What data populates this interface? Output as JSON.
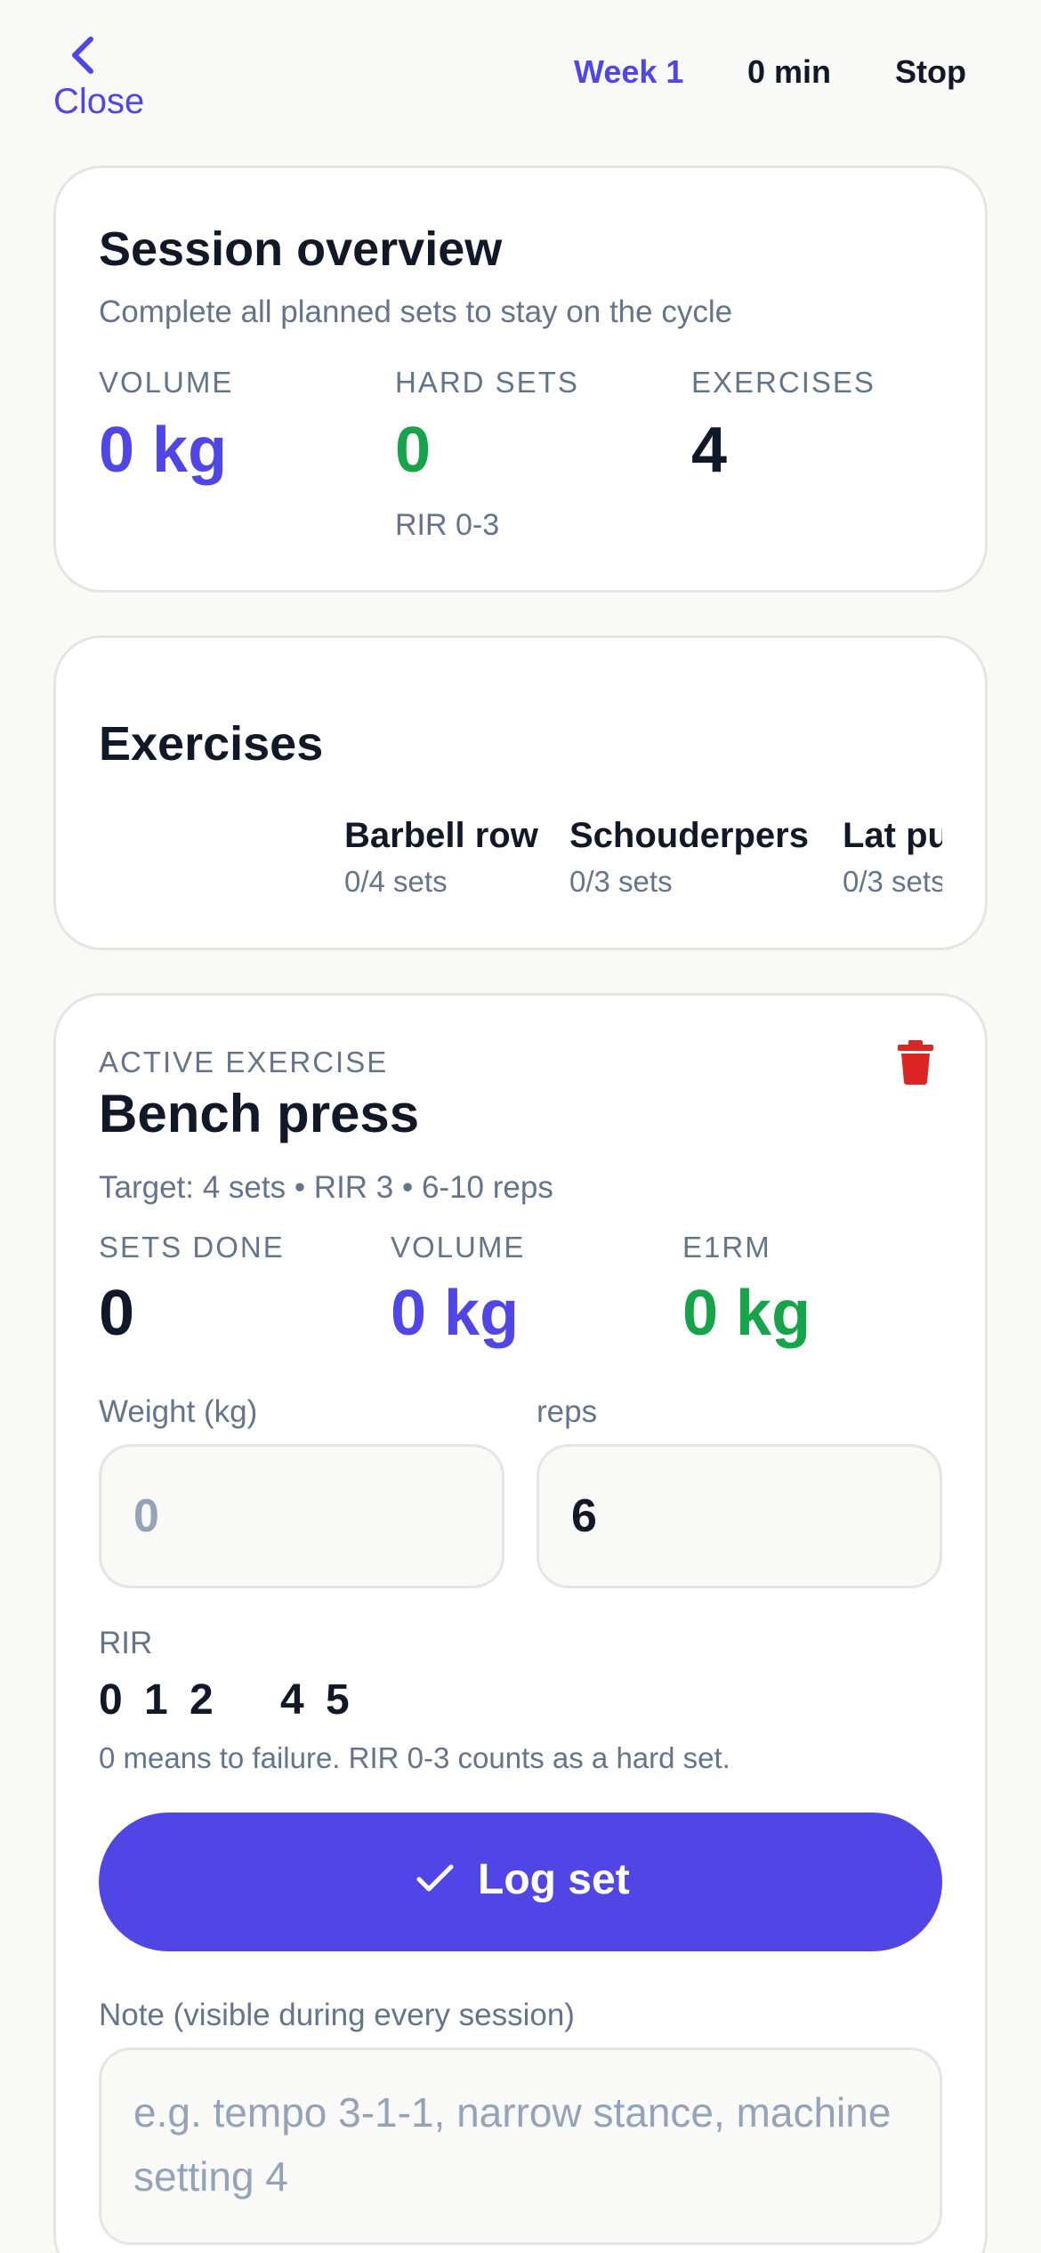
{
  "header": {
    "close_label": "Close",
    "week_label": "Week 1",
    "duration": "0 min",
    "stop_label": "Stop"
  },
  "overview": {
    "title": "Session overview",
    "subtitle": "Complete all planned sets to stay on the cycle",
    "stats": {
      "volume_label": "VOLUME",
      "volume_value": "0 kg",
      "hard_sets_label": "HARD SETS",
      "hard_sets_value": "0",
      "hard_sets_note": "RIR 0-3",
      "exercises_label": "EXERCISES",
      "exercises_value": "4"
    }
  },
  "exercises": {
    "title": "Exercises",
    "items": [
      {
        "name": "Barbell row",
        "sets": "0/4 sets"
      },
      {
        "name": "Schouderpers",
        "sets": "0/3 sets"
      },
      {
        "name": "Lat pulldown",
        "sets": "0/3 sets"
      }
    ]
  },
  "active": {
    "caption": "ACTIVE EXERCISE",
    "name": "Bench press",
    "target": "Target: 4 sets • RIR 3 • 6-10 reps",
    "stats": {
      "sets_done_label": "SETS DONE",
      "sets_done_value": "0",
      "volume_label": "VOLUME",
      "volume_value": "0 kg",
      "e1rm_label": "E1RM",
      "e1rm_value": "0 kg"
    },
    "weight": {
      "label": "Weight (kg)",
      "placeholder": "0",
      "value": ""
    },
    "reps": {
      "label": "reps",
      "value": "6"
    },
    "rir": {
      "label": "RIR",
      "options": [
        "0",
        "1",
        "2",
        "4",
        "5"
      ],
      "hint": "0 means to failure. RIR 0-3 counts as a hard set."
    },
    "log_label": "Log set",
    "note": {
      "label": "Note (visible during every session)",
      "placeholder": "e.g. tempo 3-1-1, narrow stance, machine setting 4"
    }
  },
  "colors": {
    "accent": "#4f46e5",
    "success": "#16a34a",
    "danger": "#dc2626",
    "background": "#f9f9f8"
  },
  "icons": {
    "close": "chevron-left-icon",
    "delete": "trash-icon",
    "log": "check-icon"
  }
}
